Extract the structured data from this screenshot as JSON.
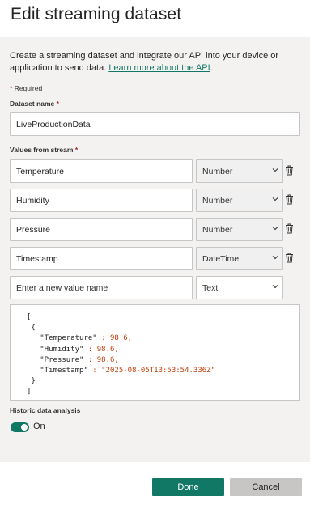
{
  "dialog": {
    "title": "Edit streaming dataset",
    "intro_text": "Create a streaming dataset and integrate our API into your device or application to send data. ",
    "intro_link": "Learn more about the API",
    "intro_tail": ".",
    "required_star": "*",
    "required_note": "Required"
  },
  "dataset_name": {
    "label": "Dataset name",
    "value": "LiveProductionData"
  },
  "values": {
    "label": "Values from stream",
    "rows": [
      {
        "name": "Temperature",
        "type": "Number"
      },
      {
        "name": "Humidity",
        "type": "Number"
      },
      {
        "name": "Pressure",
        "type": "Number"
      },
      {
        "name": "Timestamp",
        "type": "DateTime"
      }
    ],
    "new_row": {
      "placeholder": "Enter a new value name",
      "type": "Text"
    }
  },
  "json_preview": {
    "open_bracket": "[",
    "open_brace": "{",
    "lines": [
      {
        "key": "\"Temperature\"",
        "sep": " : ",
        "value": "98.6",
        "tail": ","
      },
      {
        "key": "\"Humidity\"",
        "sep": " : ",
        "value": "98.6",
        "tail": ","
      },
      {
        "key": "\"Pressure\"",
        "sep": " : ",
        "value": "98.6",
        "tail": ","
      },
      {
        "key": "\"Timestamp\"",
        "sep": " : ",
        "value": "\"2025-08-05T13:53:54.336Z\"",
        "tail": ""
      }
    ],
    "close_brace": "}",
    "close_bracket": "]"
  },
  "historic": {
    "label": "Historic data analysis",
    "state_label": "On",
    "enabled": true
  },
  "footer": {
    "done_label": "Done",
    "cancel_label": "Cancel"
  },
  "colors": {
    "accent": "#117865",
    "required": "#a4262c",
    "panel_bg": "#f3f2f1"
  },
  "icons": {
    "trash": "trash-icon",
    "chevron": "chevron-down-icon"
  }
}
